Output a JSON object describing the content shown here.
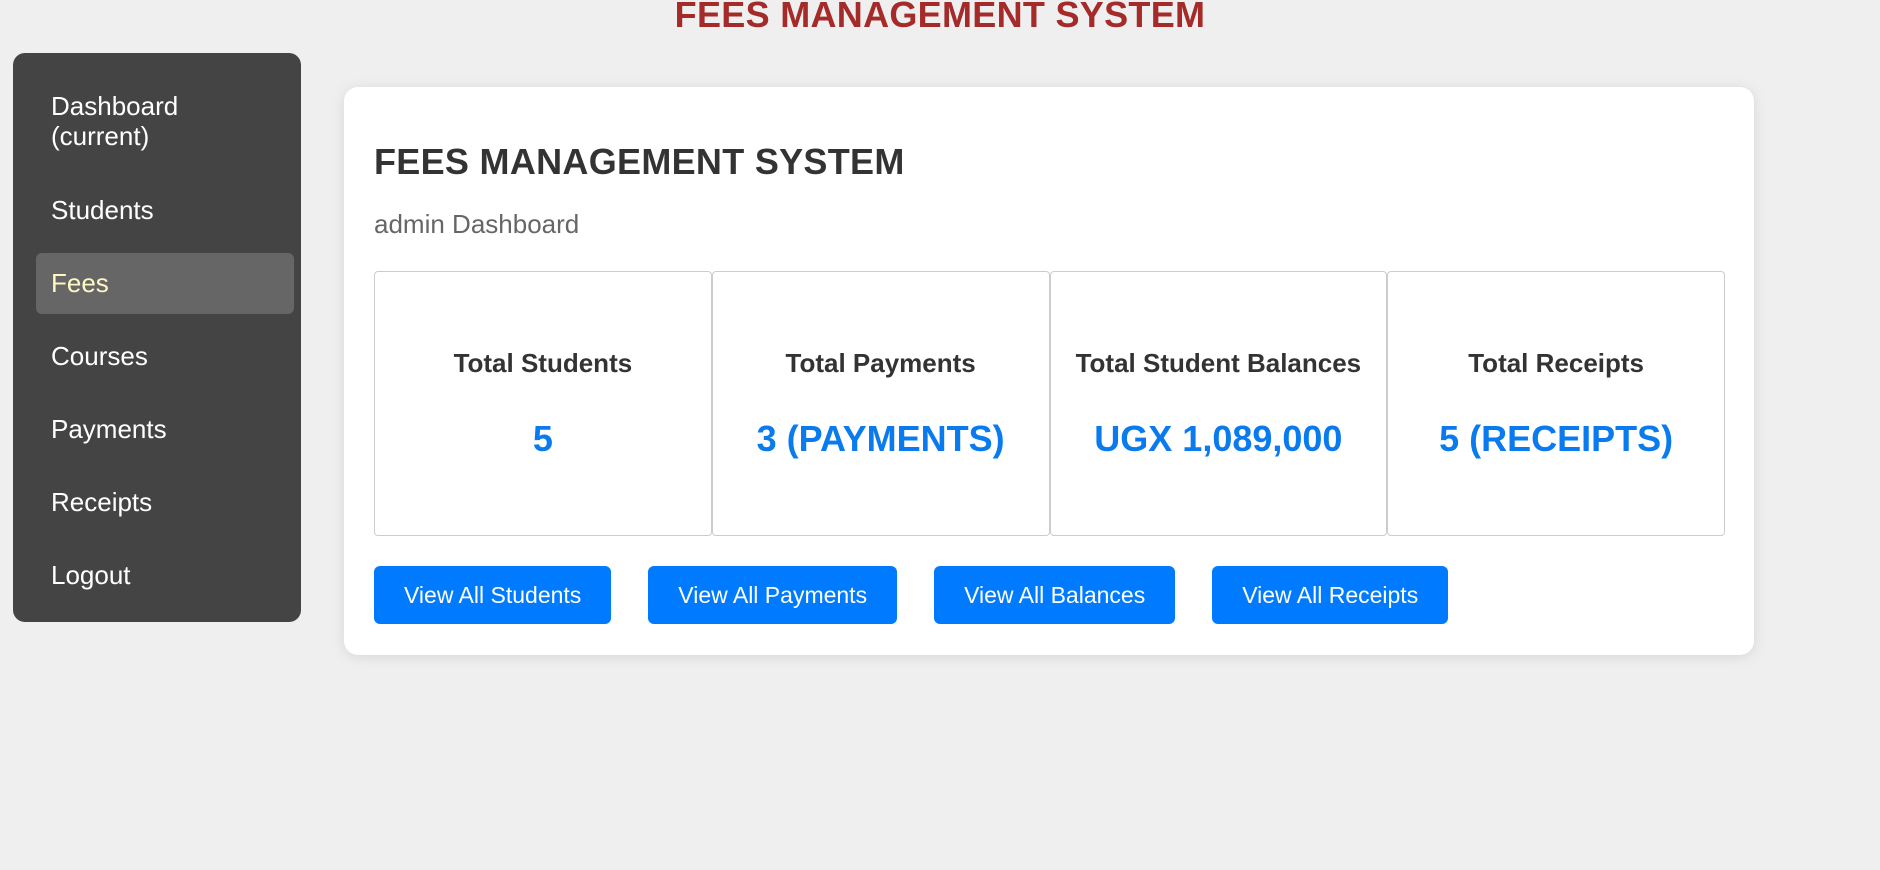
{
  "header": {
    "title": "FEES MANAGEMENT SYSTEM"
  },
  "sidebar": {
    "items": [
      {
        "label": "Dashboard (current)",
        "active": false
      },
      {
        "label": "Students",
        "active": false
      },
      {
        "label": "Fees",
        "active": true
      },
      {
        "label": "Courses",
        "active": false
      },
      {
        "label": "Payments",
        "active": false
      },
      {
        "label": "Receipts",
        "active": false
      },
      {
        "label": "Logout",
        "active": false
      }
    ]
  },
  "main": {
    "title": "FEES MANAGEMENT SYSTEM",
    "subtitle": "admin Dashboard",
    "stats": [
      {
        "label": "Total Students",
        "value": "5"
      },
      {
        "label": "Total Payments",
        "value": "3 (PAYMENTS)"
      },
      {
        "label": "Total Student Balances",
        "value": "UGX 1,089,000"
      },
      {
        "label": "Total Receipts",
        "value": "5 (RECEIPTS)"
      }
    ],
    "buttons": [
      {
        "label": "View All Students"
      },
      {
        "label": "View All Payments"
      },
      {
        "label": "View All Balances"
      },
      {
        "label": "View All Receipts"
      }
    ]
  },
  "colors": {
    "title_red": "#a52a2a",
    "sidebar_bg": "#444444",
    "active_item_bg": "#666666",
    "active_item_text": "#fff7c2",
    "accent_blue": "#007bff",
    "stat_value_blue": "#0a7bef",
    "page_bg": "#efefef"
  }
}
